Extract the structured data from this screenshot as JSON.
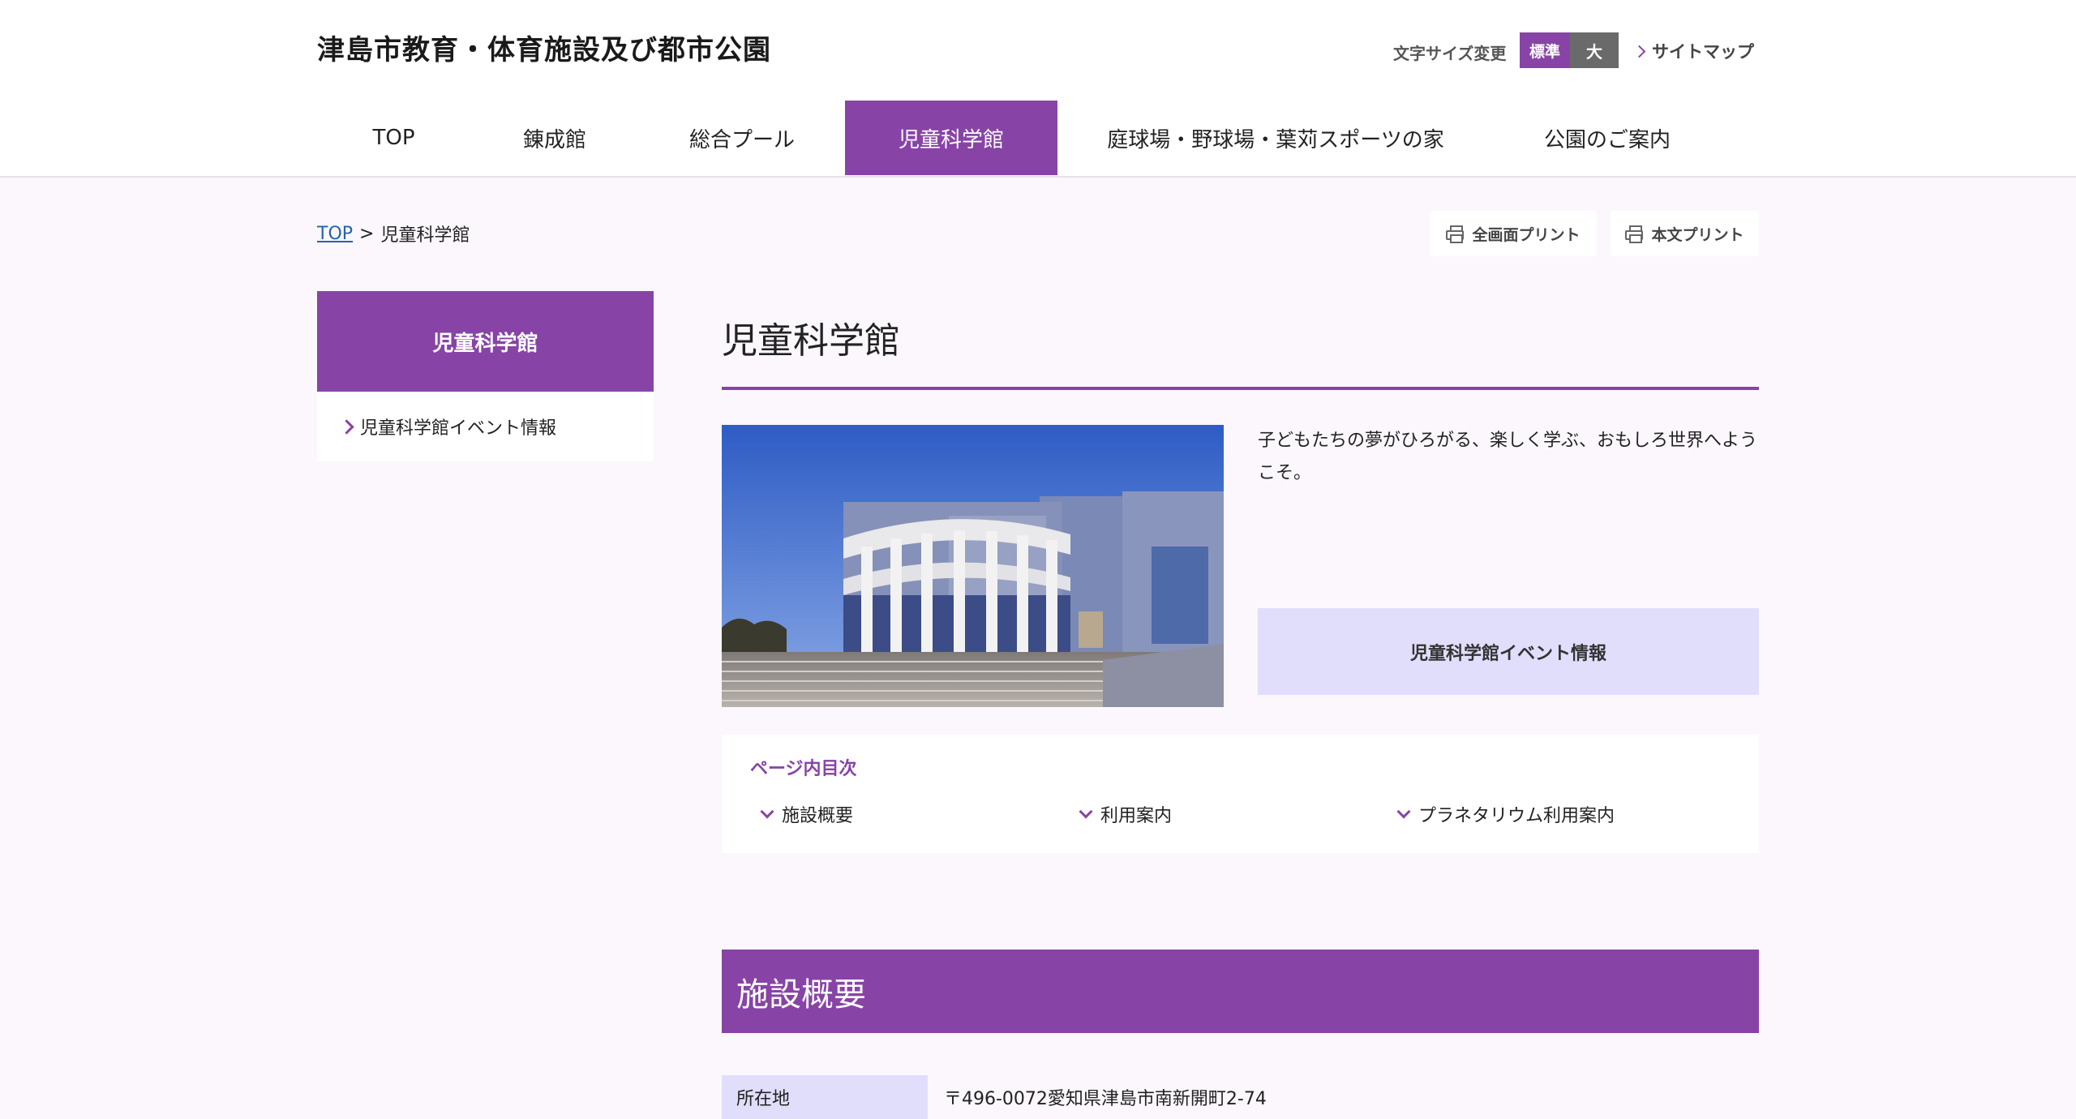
{
  "header": {
    "site_title": "津島市教育・体育施設及び都市公園",
    "fontsize_label": "文字サイズ変更",
    "fontsize_standard": "標準",
    "fontsize_large": "大",
    "sitemap": "サイトマップ"
  },
  "nav": {
    "items": [
      {
        "label": "TOP"
      },
      {
        "label": "錬成館"
      },
      {
        "label": "総合プール"
      },
      {
        "label": "児童科学館",
        "active": true
      },
      {
        "label": "庭球場・野球場・葉苅スポーツの家"
      },
      {
        "label": "公園のご案内"
      }
    ]
  },
  "breadcrumb": {
    "home": "TOP",
    "separator": ">",
    "current": "児童科学館"
  },
  "print": {
    "full": "全画面プリント",
    "body": "本文プリント"
  },
  "sidebar": {
    "heading": "児童科学館",
    "items": [
      {
        "label": "児童科学館イベント情報"
      }
    ]
  },
  "main": {
    "title": "児童科学館",
    "intro": "子どもたちの夢がひろがる、楽しく学ぶ、おもしろ世界へようこそ。",
    "event_link": "児童科学館イベント情報",
    "toc": {
      "title": "ページ内目次",
      "items": [
        {
          "label": "施設概要"
        },
        {
          "label": "利用案内"
        },
        {
          "label": "プラネタリウム利用案内"
        }
      ]
    },
    "section_title": "施設概要",
    "info": [
      {
        "label": "所在地",
        "value": "〒496-0072愛知県津島市南新開町2-74"
      }
    ]
  },
  "colors": {
    "accent": "#8744a6",
    "accent_light": "#e1defc",
    "background": "#fbf7fd"
  }
}
